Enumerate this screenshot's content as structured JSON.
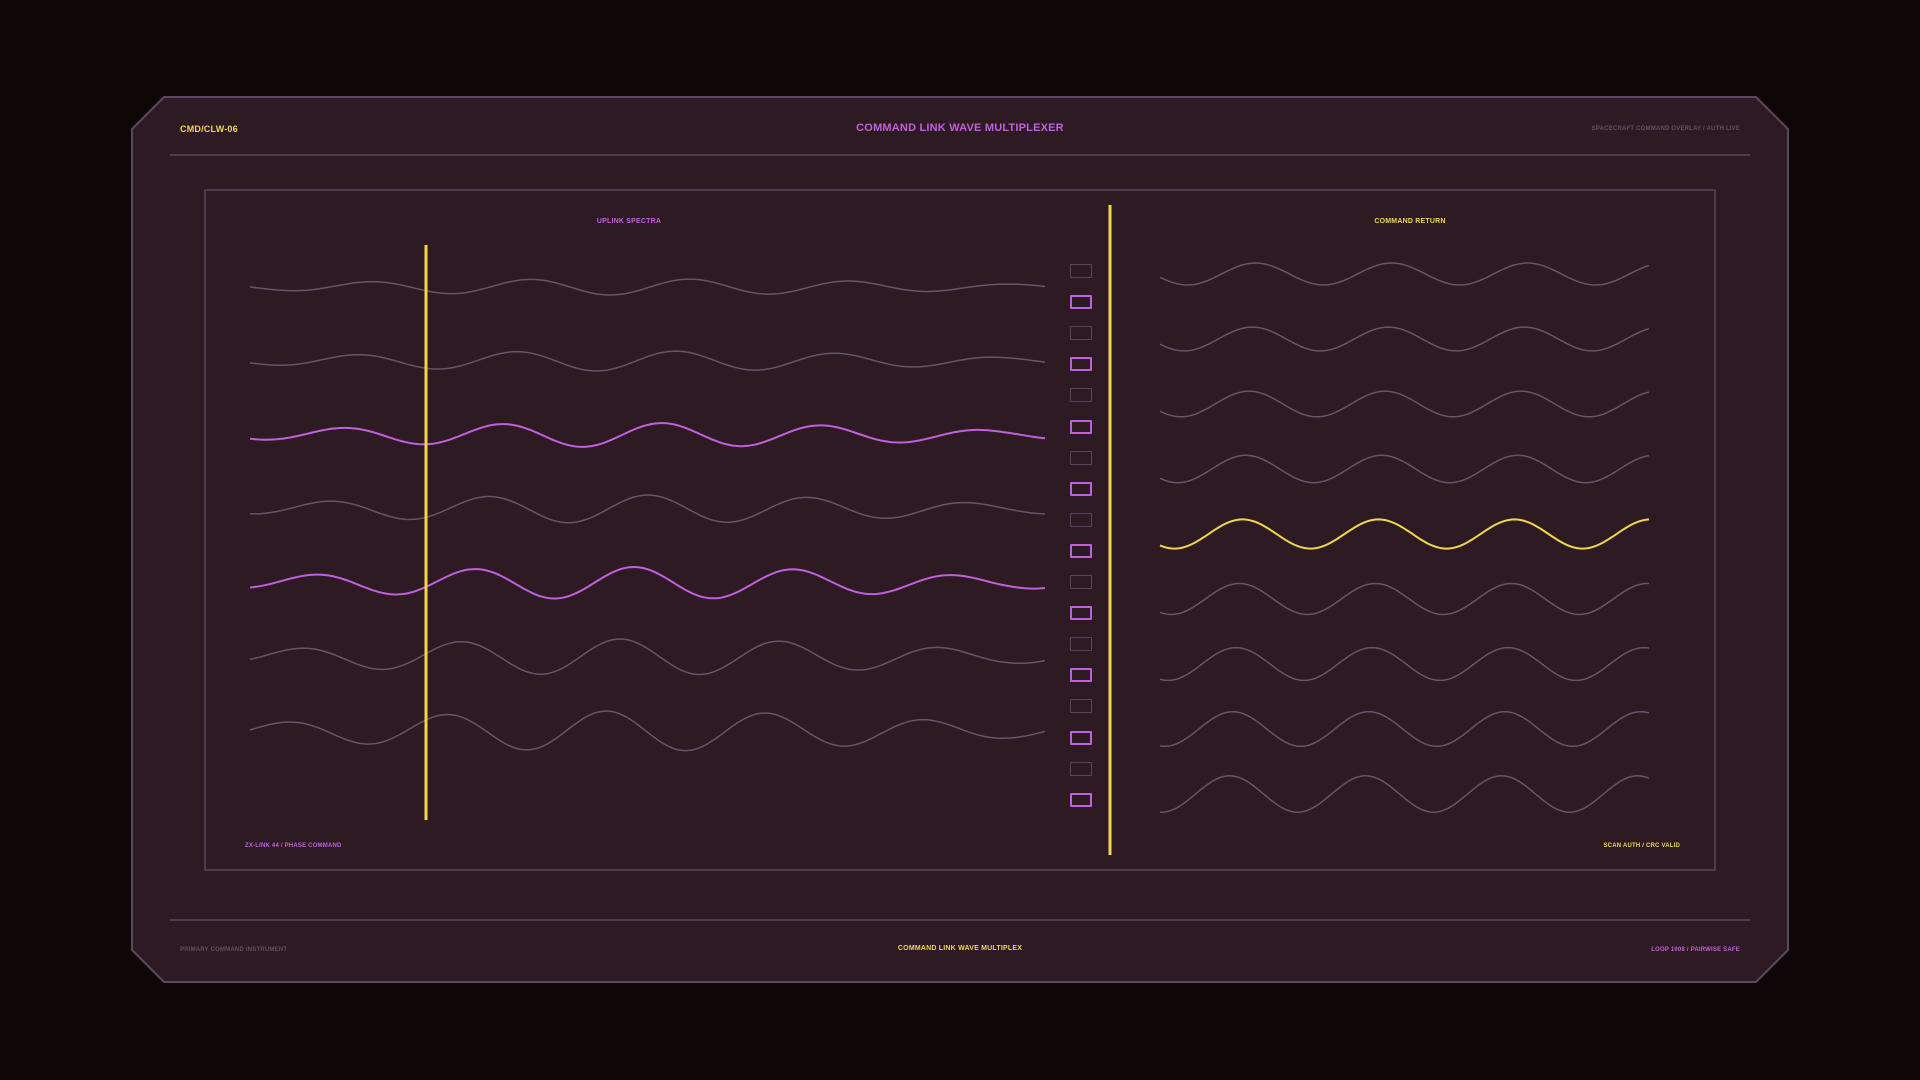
{
  "header": {
    "id_code": "CMD/CLW-06",
    "title": "COMMAND LINK WAVE MULTIPLEXER",
    "subtitle": "SPACECRAFT COMMAND OVERLAY / AUTH LIVE"
  },
  "left_panel": {
    "title": "UPLINK SPECTRA",
    "footer_label": "ZX-LINK 44 / PHASE COMMAND",
    "highlighted_waves": [
      3,
      5
    ],
    "wave_count": 7
  },
  "right_panel": {
    "title": "COMMAND RETURN",
    "footer_label": "SCAN AUTH / CRC VALID",
    "highlighted_waves": [
      5
    ],
    "wave_count": 9
  },
  "channel_selector": {
    "count": 18,
    "active_channels": [
      2,
      4,
      6,
      8,
      10,
      12,
      14,
      16,
      18
    ]
  },
  "footer": {
    "left": "PRIMARY COMMAND INSTRUMENT",
    "center": "COMMAND LINK WAVE MULTIPLEX",
    "right": "LOOP 1008 / PAIRWISE SAFE"
  },
  "colors": {
    "background": "#0f0608",
    "panel": "#2d1a22",
    "frame": "#5a4760",
    "accent_yellow": "#f0d84a",
    "accent_purple": "#c060dc",
    "dim_wave": "#65556b"
  }
}
